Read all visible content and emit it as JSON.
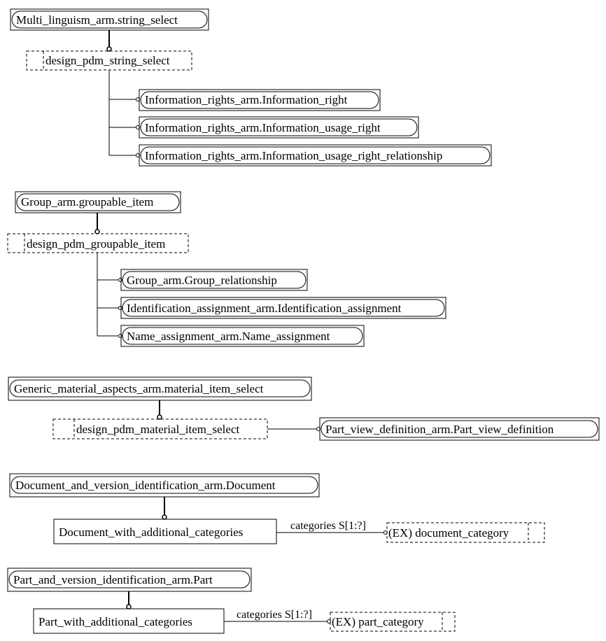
{
  "diagram": {
    "groups": [
      {
        "parent": {
          "label": "Multi_linguism_arm.string_select",
          "kind": "select-reference"
        },
        "child": {
          "label": "design_pdm_string_select",
          "kind": "select"
        },
        "targets": [
          {
            "label": "Information_rights_arm.Information_right",
            "kind": "entity-reference"
          },
          {
            "label": "Information_rights_arm.Information_usage_right",
            "kind": "entity-reference"
          },
          {
            "label": "Information_rights_arm.Information_usage_right_relationship",
            "kind": "entity-reference"
          }
        ]
      },
      {
        "parent": {
          "label": "Group_arm.groupable_item",
          "kind": "select-reference"
        },
        "child": {
          "label": "design_pdm_groupable_item",
          "kind": "select"
        },
        "targets": [
          {
            "label": "Group_arm.Group_relationship",
            "kind": "entity-reference"
          },
          {
            "label": "Identification_assignment_arm.Identification_assignment",
            "kind": "entity-reference"
          },
          {
            "label": "Name_assignment_arm.Name_assignment",
            "kind": "entity-reference"
          }
        ]
      },
      {
        "parent": {
          "label": "Generic_material_aspects_arm.material_item_select",
          "kind": "select-reference"
        },
        "child": {
          "label": "design_pdm_material_item_select",
          "kind": "select"
        },
        "targets": [
          {
            "label": "Part_view_definition_arm.Part_view_definition",
            "kind": "entity-reference"
          }
        ]
      },
      {
        "parent": {
          "label": "Document_and_version_identification_arm.Document",
          "kind": "entity-reference"
        },
        "child": {
          "label": "Document_with_additional_categories",
          "kind": "entity"
        },
        "attribute": {
          "label": "categories S[1:?]",
          "target": "(EX) document_category",
          "target_kind": "external-select"
        }
      },
      {
        "parent": {
          "label": "Part_and_version_identification_arm.Part",
          "kind": "entity-reference"
        },
        "child": {
          "label": "Part_with_additional_categories",
          "kind": "entity"
        },
        "attribute": {
          "label": "categories S[1:?]",
          "target": "(EX) part_category",
          "target_kind": "external-select"
        }
      }
    ]
  }
}
